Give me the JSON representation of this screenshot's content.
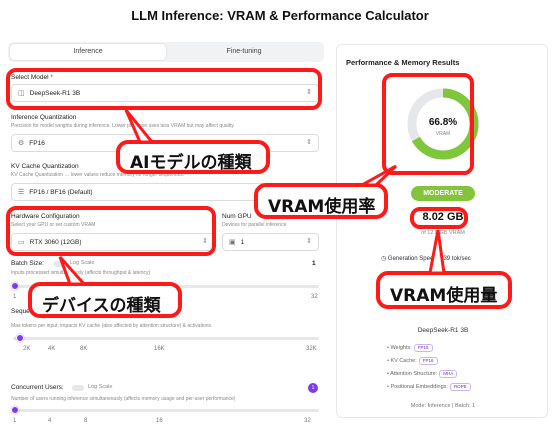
{
  "page_title": "LLM Inference: VRAM & Performance Calculator",
  "tabs": [
    "Inference",
    "Fine-tuning"
  ],
  "select_model": {
    "label": "Select Model",
    "required_mark": "*",
    "value": "DeepSeek-R1 3B"
  },
  "inference_quant": {
    "label": "Inference Quantization",
    "desc": "Precision for model weights during inference. Lower precision uses less VRAM but may affect quality.",
    "value": "FP16"
  },
  "kv_quant": {
    "label": "KV Cache Quantization",
    "desc": "KV Cache Quantization … lower values reduce memory for longer sequences.",
    "value": "FP16 / BF16 (Default)"
  },
  "hardware": {
    "label": "Hardware Configuration",
    "desc": "Select your GPU or set custom VRAM",
    "value": "RTX 3060 (12GB)"
  },
  "num_gpus": {
    "label": "Num GPU",
    "desc": "Devices for parallel inference",
    "value": "1"
  },
  "batch": {
    "label": "Batch Size:",
    "log_label": "Log Scale",
    "desc": "Inputs processed simultaneously (affects throughput & latency)",
    "value": "1",
    "min": "1",
    "max": "32"
  },
  "sequence": {
    "label": "Seque",
    "desc": "Max tokens per input; impacts KV cache (also affected by attention structure) & activations.",
    "ticks": [
      "2K",
      "4K",
      "8K",
      "16K",
      "32K"
    ]
  },
  "concurrent": {
    "label": "Concurrent Users:",
    "log_label": "Log Scale",
    "desc": "Number of users running inference simultaneously (affects memory usage and per-user performance)",
    "value": "1",
    "ticks": [
      "1",
      "4",
      "8",
      "16",
      "32"
    ]
  },
  "results": {
    "title": "Performance & Memory Results",
    "gauge_pct": "66.8%",
    "gauge_value": 0.668,
    "gauge_sub": "VRAM",
    "status": "MODERATE",
    "vram_used": "8.02 GB",
    "vram_total": "of 12.0 GB VRAM",
    "gen_speed": "Generation Speed: ~39 tok/sec",
    "model_name": "DeepSeek-R1 3B",
    "specs": [
      {
        "label": "• Weights:",
        "badge": "FP16"
      },
      {
        "label": "• KV Cache:",
        "badge": "FP16"
      },
      {
        "label": "• Attention Structure:",
        "badge": "MHA"
      },
      {
        "label": "• Positional Embeddings:",
        "badge": "ROPE"
      }
    ],
    "mode_row": "Mode: Inference | Batch: 1"
  },
  "callouts": {
    "ai_model_type": "AIモデルの種類",
    "vram_rate": "VRAM使用率",
    "device_type": "デバイスの種類",
    "vram_amount": "VRAM使用量"
  },
  "colors": {
    "accent": "#7c3aed",
    "gauge": "#7ec63a",
    "highlight": "#ff1a1a"
  }
}
